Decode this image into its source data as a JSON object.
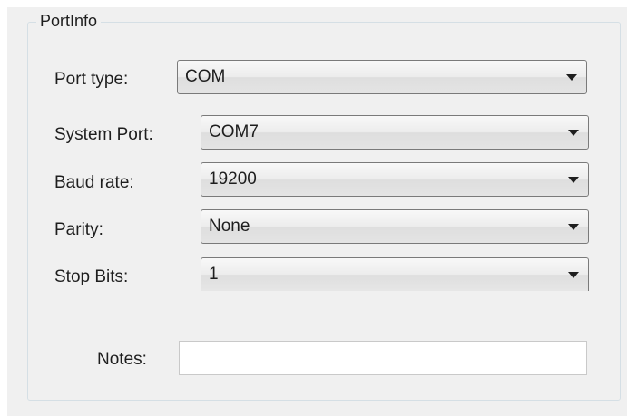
{
  "group": {
    "title": "PortInfo"
  },
  "port_type": {
    "label": "Port type:",
    "value": "COM"
  },
  "system_port": {
    "label": "System Port:",
    "value": "COM7"
  },
  "baud_rate": {
    "label": "Baud rate:",
    "value": "19200"
  },
  "parity": {
    "label": "Parity:",
    "value": "None"
  },
  "stop_bits": {
    "label": "Stop Bits:",
    "value": "1"
  },
  "notes": {
    "label": "Notes:",
    "value": ""
  },
  "icons": {
    "dropdown": "chevron-down-icon"
  }
}
